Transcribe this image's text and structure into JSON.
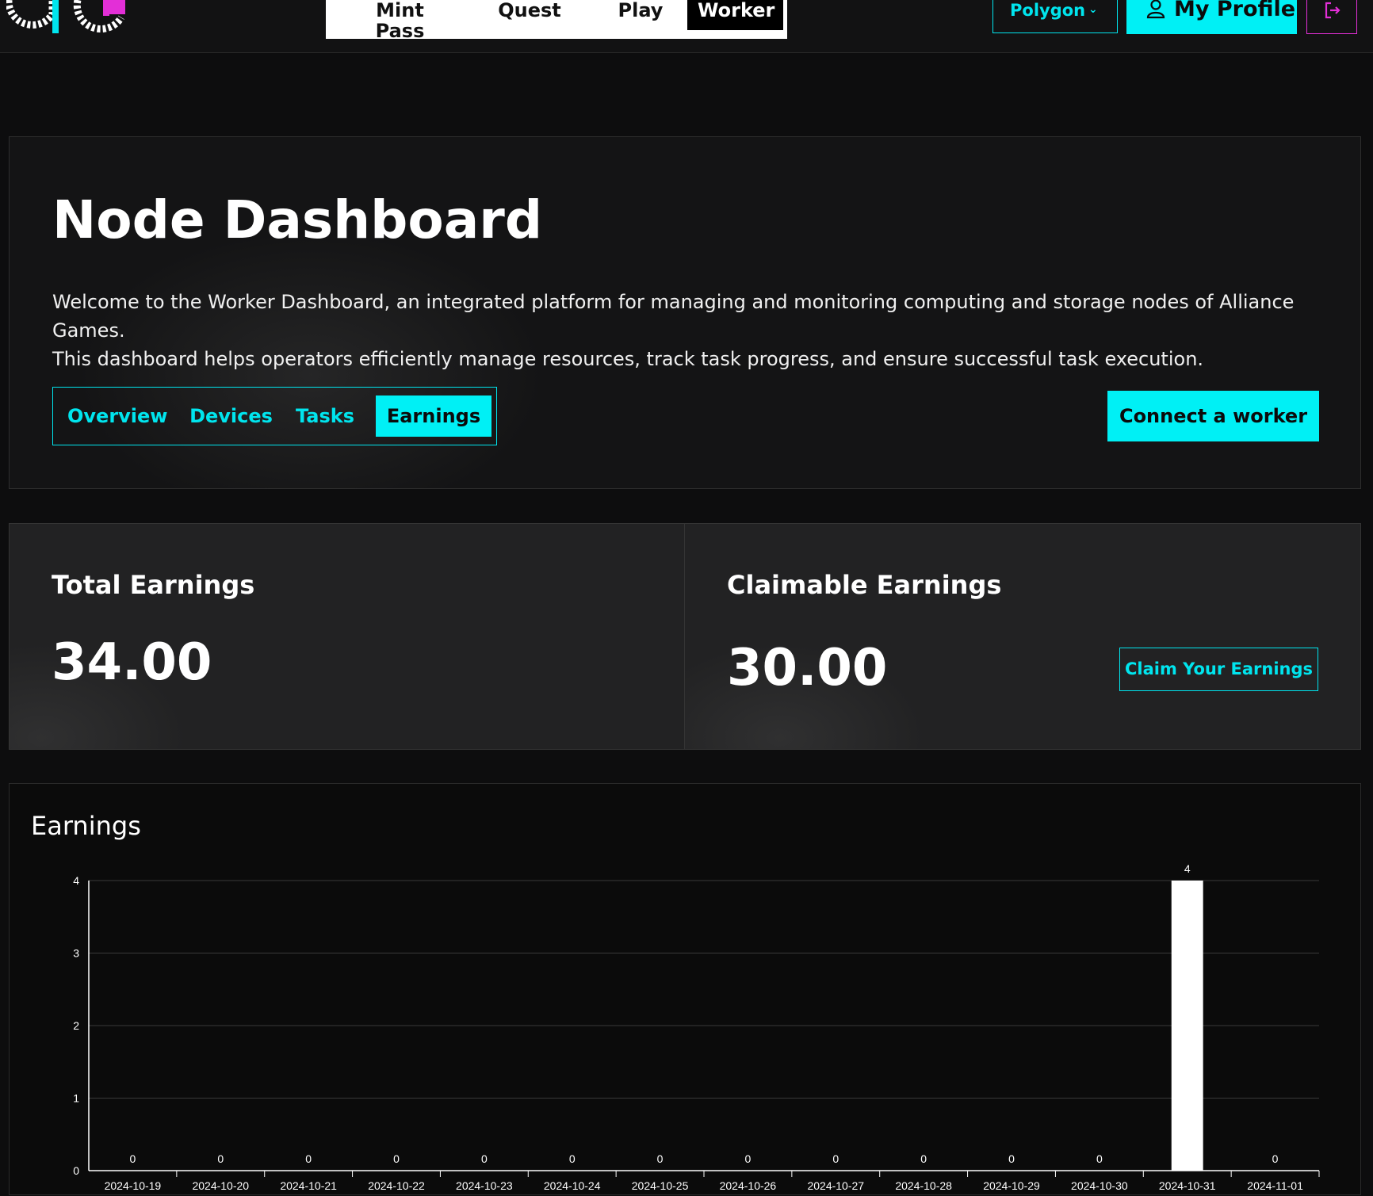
{
  "header": {
    "nav": [
      {
        "label": "Mint Pass"
      },
      {
        "label": "Quest"
      },
      {
        "label": "Play"
      },
      {
        "label": "Worker"
      }
    ],
    "network": "Polygon",
    "profile_label": "My Profile"
  },
  "hero": {
    "title": "Node Dashboard",
    "description_line1": "Welcome to the Worker Dashboard, an integrated platform for managing and monitoring computing and storage nodes of Alliance Games.",
    "description_line2": "This dashboard helps operators efficiently manage resources, track task progress, and ensure successful task execution.",
    "tabs": [
      {
        "label": "Overview"
      },
      {
        "label": "Devices"
      },
      {
        "label": "Tasks"
      },
      {
        "label": "Earnings"
      }
    ],
    "active_tab": "Earnings",
    "connect_label": "Connect a worker"
  },
  "earnings": {
    "total_title": "Total Earnings",
    "total_value": "34.00",
    "claimable_title": "Claimable Earnings",
    "claimable_value": "30.00",
    "claim_label": "Claim Your Earnings"
  },
  "chart_panel": {
    "title": "Earnings"
  },
  "colors": {
    "accent": "#00f0f5",
    "logout_border": "#e32fd7",
    "background": "#0d0d0e",
    "bar": "#ffffff"
  },
  "chart_data": {
    "type": "bar",
    "categories": [
      "2024-10-19",
      "2024-10-20",
      "2024-10-21",
      "2024-10-22",
      "2024-10-23",
      "2024-10-24",
      "2024-10-25",
      "2024-10-26",
      "2024-10-27",
      "2024-10-28",
      "2024-10-29",
      "2024-10-30",
      "2024-10-31",
      "2024-11-01"
    ],
    "values": [
      0,
      0,
      0,
      0,
      0,
      0,
      0,
      0,
      0,
      0,
      0,
      0,
      4,
      0
    ],
    "yticks": [
      0,
      1,
      2,
      3,
      4
    ],
    "ylim": [
      0,
      4
    ],
    "grid": true,
    "data_labels": true
  }
}
